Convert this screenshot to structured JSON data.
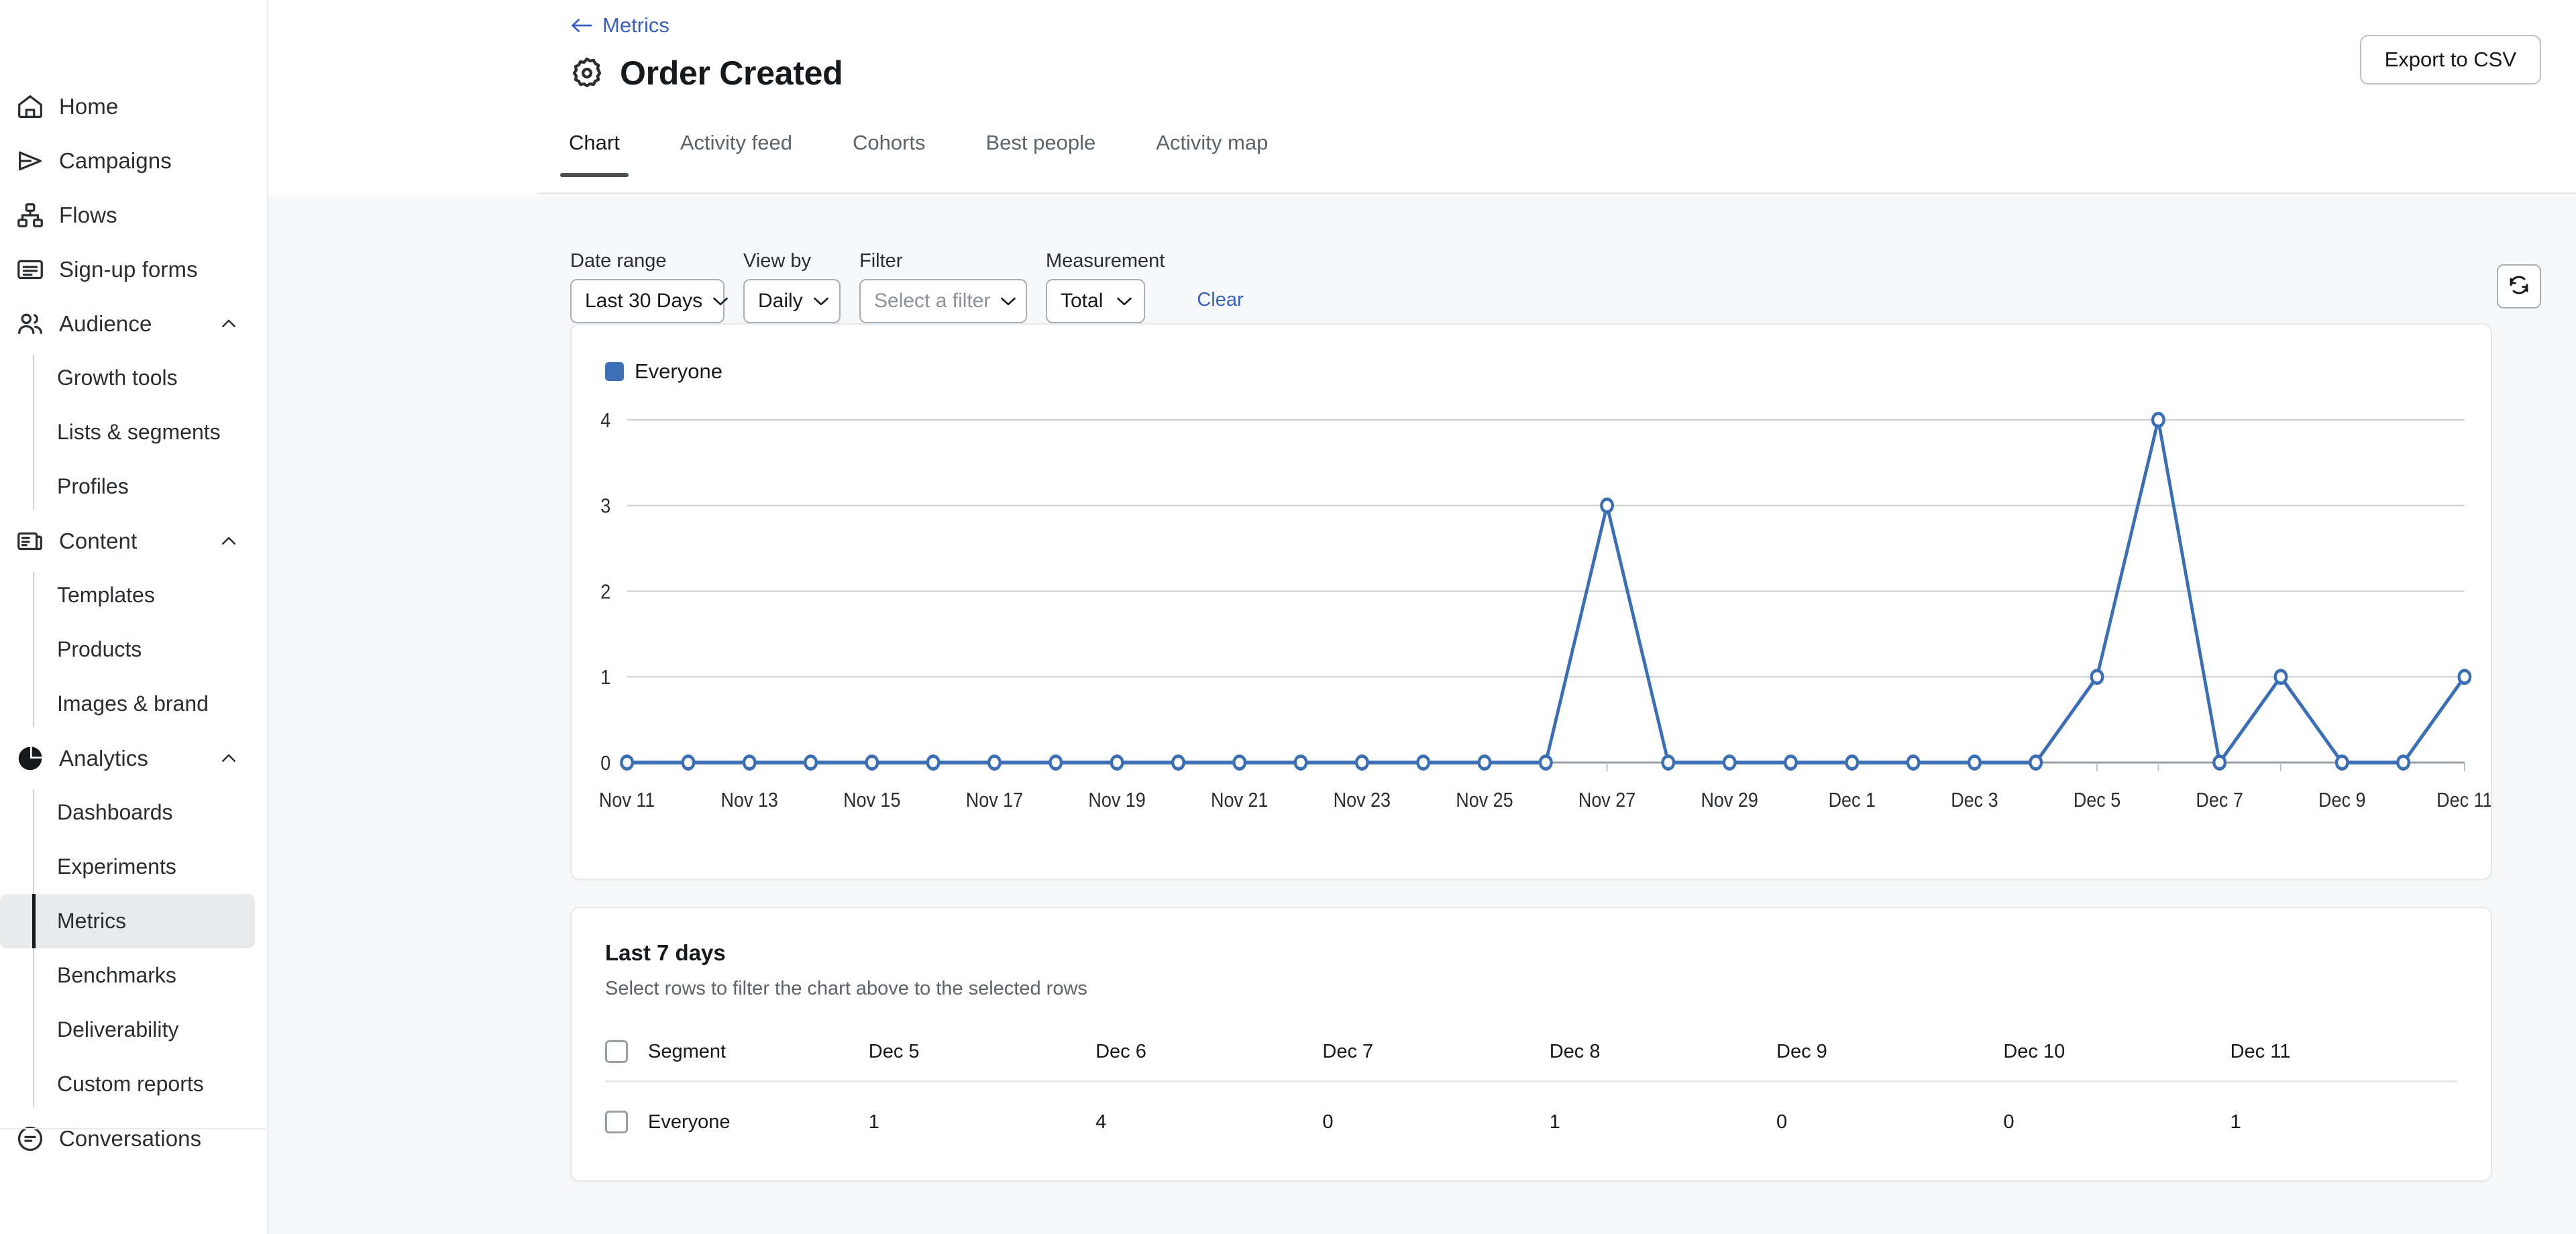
{
  "sidebar": {
    "items": [
      {
        "label": "Home",
        "icon": "home-icon",
        "type": "top"
      },
      {
        "label": "Campaigns",
        "icon": "send-icon",
        "type": "top"
      },
      {
        "label": "Flows",
        "icon": "flows-icon",
        "type": "top"
      },
      {
        "label": "Sign-up forms",
        "icon": "form-icon",
        "type": "top"
      },
      {
        "label": "Audience",
        "icon": "people-icon",
        "type": "group",
        "expanded": true
      },
      {
        "label": "Growth tools",
        "type": "sub"
      },
      {
        "label": "Lists & segments",
        "type": "sub"
      },
      {
        "label": "Profiles",
        "type": "sub"
      },
      {
        "label": "Content",
        "icon": "content-icon",
        "type": "group",
        "expanded": true
      },
      {
        "label": "Templates",
        "type": "sub"
      },
      {
        "label": "Products",
        "type": "sub"
      },
      {
        "label": "Images & brand",
        "type": "sub"
      },
      {
        "label": "Analytics",
        "icon": "pie-icon",
        "type": "group",
        "expanded": true
      },
      {
        "label": "Dashboards",
        "type": "sub"
      },
      {
        "label": "Experiments",
        "type": "sub"
      },
      {
        "label": "Metrics",
        "type": "sub",
        "active": true
      },
      {
        "label": "Benchmarks",
        "type": "sub"
      },
      {
        "label": "Deliverability",
        "type": "sub"
      },
      {
        "label": "Custom reports",
        "type": "sub"
      },
      {
        "label": "Conversations",
        "icon": "chat-icon",
        "type": "top"
      }
    ]
  },
  "header": {
    "breadcrumb_label": "Metrics",
    "title": "Order Created",
    "export_label": "Export to CSV",
    "tabs": [
      {
        "label": "Chart",
        "active": true
      },
      {
        "label": "Activity feed",
        "active": false
      },
      {
        "label": "Cohorts",
        "active": false
      },
      {
        "label": "Best people",
        "active": false
      },
      {
        "label": "Activity map",
        "active": false
      }
    ]
  },
  "filters": {
    "date_range": {
      "label": "Date range",
      "value": "Last 30 Days"
    },
    "view_by": {
      "label": "View by",
      "value": "Daily"
    },
    "filter": {
      "label": "Filter",
      "placeholder": "Select a filter",
      "value": ""
    },
    "measurement": {
      "label": "Measurement",
      "value": "Total"
    },
    "clear_label": "Clear",
    "refresh_icon": "refresh-icon"
  },
  "chart_data": {
    "type": "line",
    "title": "",
    "xlabel": "",
    "ylabel": "",
    "legend": [
      {
        "name": "Everyone",
        "color": "#3b6eb5"
      }
    ],
    "legend_position": "top-left",
    "grid": true,
    "ylim": [
      0,
      4
    ],
    "yticks": [
      0,
      1,
      2,
      3,
      4
    ],
    "x": [
      "Nov 11",
      "Nov 12",
      "Nov 13",
      "Nov 14",
      "Nov 15",
      "Nov 16",
      "Nov 17",
      "Nov 18",
      "Nov 19",
      "Nov 20",
      "Nov 21",
      "Nov 22",
      "Nov 23",
      "Nov 24",
      "Nov 25",
      "Nov 26",
      "Nov 27",
      "Nov 28",
      "Nov 29",
      "Nov 30",
      "Dec 1",
      "Dec 2",
      "Dec 3",
      "Dec 4",
      "Dec 5",
      "Dec 6",
      "Dec 7",
      "Dec 8",
      "Dec 9",
      "Dec 10",
      "Dec 11"
    ],
    "xtick_labels": [
      "Nov 11",
      "Nov 13",
      "Nov 15",
      "Nov 17",
      "Nov 19",
      "Nov 21",
      "Nov 23",
      "Nov 25",
      "Nov 27",
      "Nov 29",
      "Dec 1",
      "Dec 3",
      "Dec 5",
      "Dec 7",
      "Dec 9",
      "Dec 11"
    ],
    "series": [
      {
        "name": "Everyone",
        "color": "#3b6eb5",
        "values": [
          0,
          0,
          0,
          0,
          0,
          0,
          0,
          0,
          0,
          0,
          0,
          0,
          0,
          0,
          0,
          0,
          3,
          0,
          0,
          0,
          0,
          0,
          0,
          0,
          1,
          4,
          0,
          1,
          0,
          0,
          1
        ]
      }
    ]
  },
  "table": {
    "title": "Last 7 days",
    "subtitle": "Select rows to filter the chart above to the selected rows",
    "columns": [
      "Segment",
      "Dec 5",
      "Dec 6",
      "Dec 7",
      "Dec 8",
      "Dec 9",
      "Dec 10",
      "Dec 11"
    ],
    "rows": [
      {
        "segment": "Everyone",
        "values": [
          "1",
          "4",
          "0",
          "1",
          "0",
          "0",
          "1"
        ]
      }
    ]
  }
}
